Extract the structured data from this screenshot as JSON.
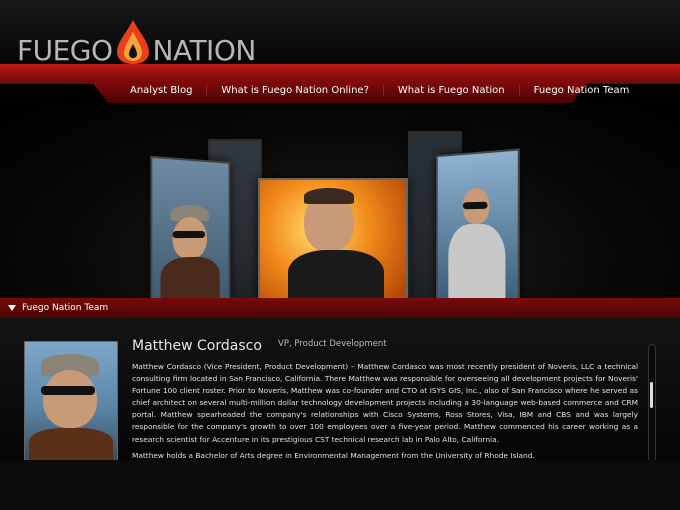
{
  "brand": {
    "left": "FUEGO",
    "right": "NATION"
  },
  "nav": {
    "items": [
      {
        "label": "Analyst Blog"
      },
      {
        "label": "What is Fuego Nation Online?"
      },
      {
        "label": "What is Fuego Nation"
      },
      {
        "label": "Fuego Nation Team"
      }
    ]
  },
  "section": {
    "title": "Fuego Nation Team"
  },
  "profile": {
    "name": "Matthew Cordasco",
    "role": "VP, Product Development",
    "bio": "Matthew Cordasco (Vice President, Product Development) – Matthew Cordasco was most recently president of Noveris, LLC a technical consulting firm located in San Francisco, California. There Matthew was responsible for overseeing all development projects for Noveris' Fortune 100 client roster. Prior to Noveris, Matthew was co-founder and CTO at ISYS GIS, Inc., also of San Francisco where he served as chief architect on several multi-million dollar technology development projects including a 30-language web-based commerce and CRM portal. Matthew spearheaded the company's relationships with Cisco Systems, Ross Stores, Visa, IBM and CBS and was largely responsible for the company's growth to over 100 employees over a five-year period. Matthew commenced his career working as a research scientist for Accenture in its prestigious CST technical research lab in Palo Alto, California.",
    "education": "Matthew holds a Bachelor of Arts degree in Environmental Management from the University of Rhode Island."
  },
  "colors": {
    "accent": "#b01515",
    "background": "#000000",
    "text": "#e2e2e2"
  }
}
